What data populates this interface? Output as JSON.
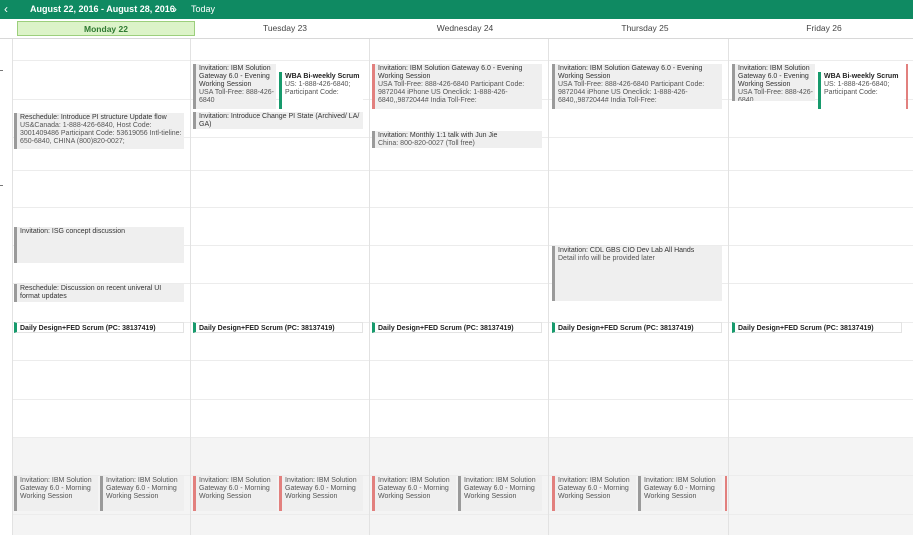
{
  "toolbar": {
    "prev_icon": "‹",
    "range": "August 22, 2016 - August 28, 2016",
    "next_icon": "›",
    "today_label": "Today"
  },
  "days": [
    {
      "label": "Monday 22",
      "today": true
    },
    {
      "label": "Tuesday 23",
      "today": false
    },
    {
      "label": "Wednesday 24",
      "today": false
    },
    {
      "label": "Thursday 25",
      "today": false
    },
    {
      "label": "Friday 26",
      "today": false
    }
  ],
  "events": {
    "mon_pi_reschedule": {
      "title": "Reschedule: Introduce PI structure Update flow",
      "detail": "US&Canada: 1-888-426-6840, Host Code: 3001409486 Participant Code: 53619056 Intl-tieline: 650-6840, CHINA (800)820-0027;"
    },
    "mon_isg": {
      "title": "Invitation: ISG concept discussion",
      "detail": ""
    },
    "mon_universal_ui": {
      "title": "Reschedule: Discussion on recent univeral UI format updates",
      "detail": ""
    },
    "tue_ibm_evening": {
      "title": "Invitation: IBM Solution Gateway 6.0 - Evening Working Session",
      "detail": "USA Toll-Free: 888-426-6840"
    },
    "tue_wba": {
      "title": "WBA Bi-weekly Scrum",
      "detail": "US: 1-888-426-6840; Participant Code:"
    },
    "tue_pi_state": {
      "title": "Invitation: Introduce Change PI State (Archived/ LA/ GA)",
      "detail": ""
    },
    "wed_ibm_evening": {
      "title": "Invitation: IBM Solution Gateway 6.0 - Evening Working Session",
      "detail": "USA Toll-Free: 888-426-6840 Participant Code: 9872044 iPhone US Oneclick: 1-888-426-6840,,9872044# India Toll-Free:"
    },
    "wed_one_on_one": {
      "title": "Invitation: Monthly 1:1 talk with Jun Jie",
      "detail": "China: 800-820-0027 (Toll free)"
    },
    "thu_ibm_evening": {
      "title": "Invitation: IBM Solution Gateway 6.0 - Evening Working Session",
      "detail": "USA Toll-Free: 888-426-6840 Participant Code: 9872044 iPhone US Oneclick: 1-888-426-6840,,9872044# India Toll-Free:"
    },
    "thu_cdl": {
      "title": "Invitation: CDL GBS CIO Dev Lab All Hands",
      "detail": "Detail info will be provided later"
    },
    "fri_ibm_evening": {
      "title": "Invitation: IBM Solution Gateway 6.0 - Evening Working Session",
      "detail": "USA Toll-Free: 888-426-6840"
    },
    "fri_wba": {
      "title": "WBA Bi-weekly Scrum",
      "detail": "US: 1-888-426-6840; Participant Code:"
    }
  },
  "daily_scrum": "Daily Design+FED Scrum (PC: 38137419)",
  "morning_session": "Invitation: IBM Solution Gateway 6.0 - Morning Working Session",
  "colors": {
    "brand": "#0f8a62",
    "today_bg": "#dcf3c8",
    "event_green": "#179a6c",
    "event_red": "#e2807e",
    "event_gray": "#9a9a9a"
  }
}
